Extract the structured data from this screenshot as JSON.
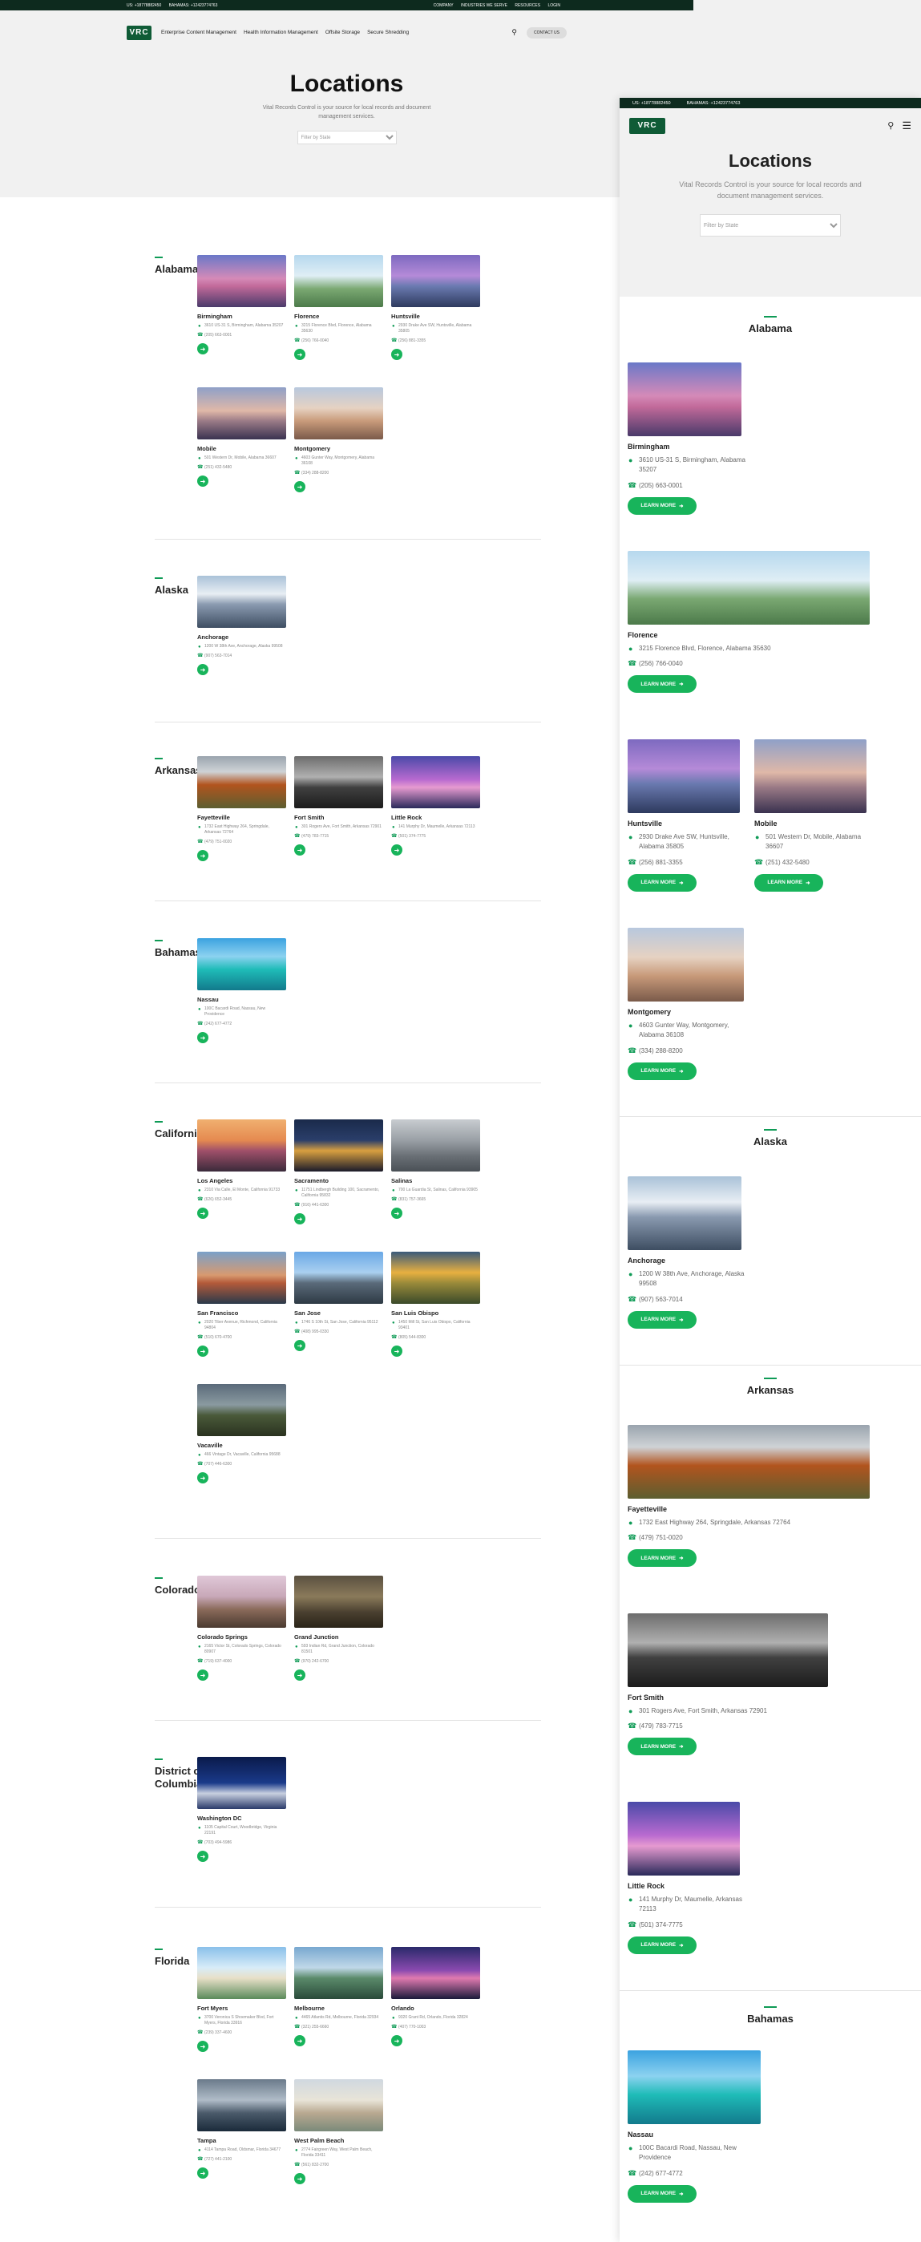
{
  "desktop": {
    "topbar": {
      "left": [
        "US: +18778882450",
        "BAHAMAS: +12423774763"
      ],
      "right": [
        "COMPANY",
        "INDUSTRIES WE SERVE",
        "RESOURCES",
        "LOGIN"
      ]
    },
    "nav": {
      "logo": "VRC",
      "links": [
        "Enterprise Content Management",
        "Health Information Management",
        "Offsite Storage",
        "Secure Shredding"
      ],
      "contact": "CONTACT US"
    },
    "hero": {
      "title": "Locations",
      "subtitle": "Vital Records Control is your source for local records and document management services.",
      "select_placeholder": "Filter by State"
    }
  },
  "mobile": {
    "topbar": [
      "US: +18778882450",
      "BAHAMAS: +12423774763"
    ],
    "logo": "VRC",
    "hero": {
      "title": "Locations",
      "subtitle": "Vital Records Control is your source for local records and document management services.",
      "select_placeholder": "Filter by State"
    },
    "learn_more": "LEARN MORE"
  },
  "states": [
    {
      "name": "Alabama",
      "cities": [
        {
          "name": "Birmingham",
          "address": "3610 US-31 S, Birmingham, Alabama 35207",
          "phone": "(205) 663-0001"
        },
        {
          "name": "Florence",
          "address": "3215 Florence Blvd, Florence, Alabama 35630",
          "phone": "(256) 766-0040"
        },
        {
          "name": "Huntsville",
          "address": "2930 Drake Ave SW, Huntsville, Alabama 35805",
          "phone": "(256) 881-3355"
        },
        {
          "name": "Mobile",
          "address": "501 Western Dr, Mobile, Alabama 36607",
          "phone": "(251) 432-5480"
        },
        {
          "name": "Montgomery",
          "address": "4603 Gunter Way, Montgomery, Alabama 36108",
          "phone": "(334) 288-8200"
        }
      ]
    },
    {
      "name": "Alaska",
      "cities": [
        {
          "name": "Anchorage",
          "address": "1200 W 38th Ave, Anchorage, Alaska 99508",
          "phone": "(907) 563-7014"
        }
      ]
    },
    {
      "name": "Arkansas",
      "cities": [
        {
          "name": "Fayetteville",
          "address": "1732 East Highway 264, Springdale, Arkansas 72764",
          "phone": "(479) 751-0020"
        },
        {
          "name": "Fort Smith",
          "address": "301 Rogers Ave, Fort Smith, Arkansas 72901",
          "phone": "(479) 783-7715"
        },
        {
          "name": "Little Rock",
          "address": "141 Murphy Dr, Maumelle, Arkansas 72113",
          "phone": "(501) 374-7775"
        }
      ]
    },
    {
      "name": "Bahamas",
      "cities": [
        {
          "name": "Nassau",
          "address": "100C Bacardi Road, Nassau, New Providence",
          "phone": "(242) 677-4772"
        }
      ]
    },
    {
      "name": "California",
      "cities": [
        {
          "name": "Los Angeles",
          "address": "2310 Via Calle, El Monte, California 91733",
          "phone": "(626) 652-3445"
        },
        {
          "name": "Sacramento",
          "address": "11751 Lindbergh Building 100, Sacramento, California 95832",
          "phone": "(916) 441-6300"
        },
        {
          "name": "Salinas",
          "address": "700 La Guardia St, Salinas, California 93905",
          "phone": "(831) 757-3665"
        },
        {
          "name": "San Francisco",
          "address": "2020 Tiber Avenue, Richmond, California 94804",
          "phone": "(510) 670-4700"
        },
        {
          "name": "San Jose",
          "address": "1746 S 10th St, San Jose, California 95112",
          "phone": "(408) 995-0330"
        },
        {
          "name": "San Luis Obispo",
          "address": "1450 Mill St, San Luis Obispo, California 93401",
          "phone": "(805) 544-8300"
        },
        {
          "name": "Vacaville",
          "address": "466 Vintage Dr, Vacaville, California 95688",
          "phone": "(707) 446-6300"
        }
      ]
    },
    {
      "name": "Colorado",
      "cities": [
        {
          "name": "Colorado Springs",
          "address": "2165 Victor St, Colorado Springs, Colorado 80907",
          "phone": "(719) 637-4000"
        },
        {
          "name": "Grand Junction",
          "address": "593 Indian Rd, Grand Junction, Colorado 81501",
          "phone": "(970) 242-6700"
        }
      ]
    },
    {
      "name": "District of Columbia",
      "cities": [
        {
          "name": "Washington DC",
          "address": "1105 Capital Court, Woodbridge, Virginia 22191",
          "phone": "(703) 494-5986"
        }
      ]
    },
    {
      "name": "Florida",
      "cities": [
        {
          "name": "Fort Myers",
          "address": "3700 Veronica S Shoemaker Blvd, Fort Myers, Florida 33916",
          "phone": "(239) 337-4600"
        },
        {
          "name": "Melbourne",
          "address": "4465 Atlantis Rd, Melbourne, Florida 32934",
          "phone": "(321) 255-6660"
        },
        {
          "name": "Orlando",
          "address": "9320 Grant Rd, Orlando, Florida 32824",
          "phone": "(407) 770-1003"
        },
        {
          "name": "Tampa",
          "address": "4114 Tampa Road, Oldsmar, Florida 34677",
          "phone": "(727) 441-2100"
        },
        {
          "name": "West Palm Beach",
          "address": "2774 Fairgreen Way, West Palm Beach, Florida 33411",
          "phone": "(561) 832-2700"
        }
      ]
    }
  ]
}
